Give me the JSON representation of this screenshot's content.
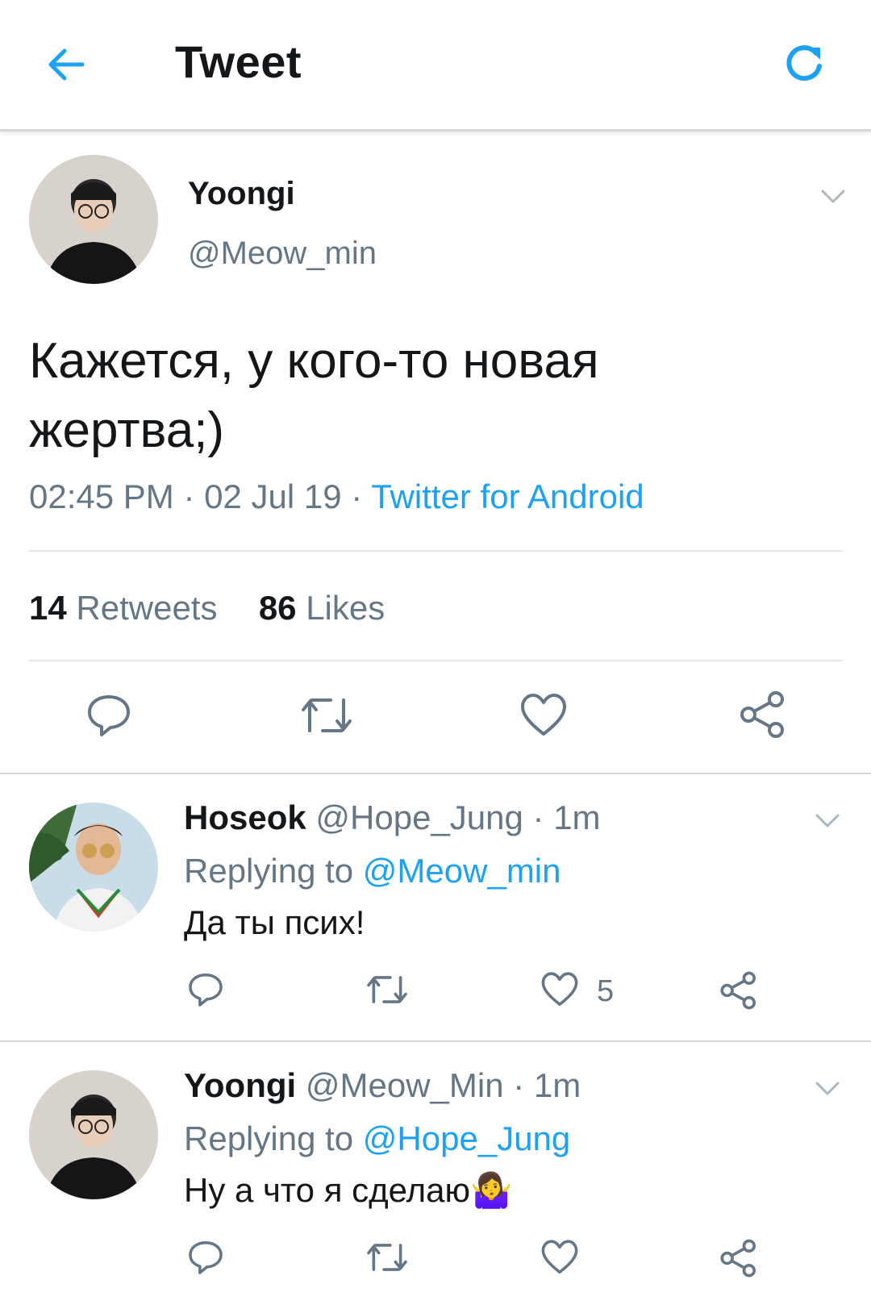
{
  "header": {
    "title": "Tweet",
    "back_icon": "arrow-left-icon",
    "refresh_icon": "refresh-icon"
  },
  "colors": {
    "accent": "#1da1f2",
    "text": "#14171a",
    "muted": "#657786",
    "divider": "#e1e8ed"
  },
  "main_tweet": {
    "display_name": "Yoongi",
    "handle": "@Meow_min",
    "text_line1": "Кажется, у кого-то новая",
    "text_line2": "жертва;)",
    "time": "02:45 PM",
    "date": "02 Jul 19",
    "sep": "·",
    "source": "Twitter for Android",
    "retweets_count": "14",
    "retweets_label": "Retweets",
    "likes_count": "86",
    "likes_label": "Likes"
  },
  "replies": [
    {
      "display_name": "Hoseok",
      "handle": "@Hope_Jung",
      "time": "· 1m",
      "replying_prefix": "Replying to",
      "replying_to": "@Meow_min",
      "text": "Да ты псих!",
      "like_count": "5"
    },
    {
      "display_name": "Yoongi",
      "handle": "@Meow_Min",
      "time": "· 1m",
      "replying_prefix": "Replying to",
      "replying_to": "@Hope_Jung",
      "text": "Ну а что я сделаю",
      "emoji": "🤷‍♀️"
    }
  ]
}
